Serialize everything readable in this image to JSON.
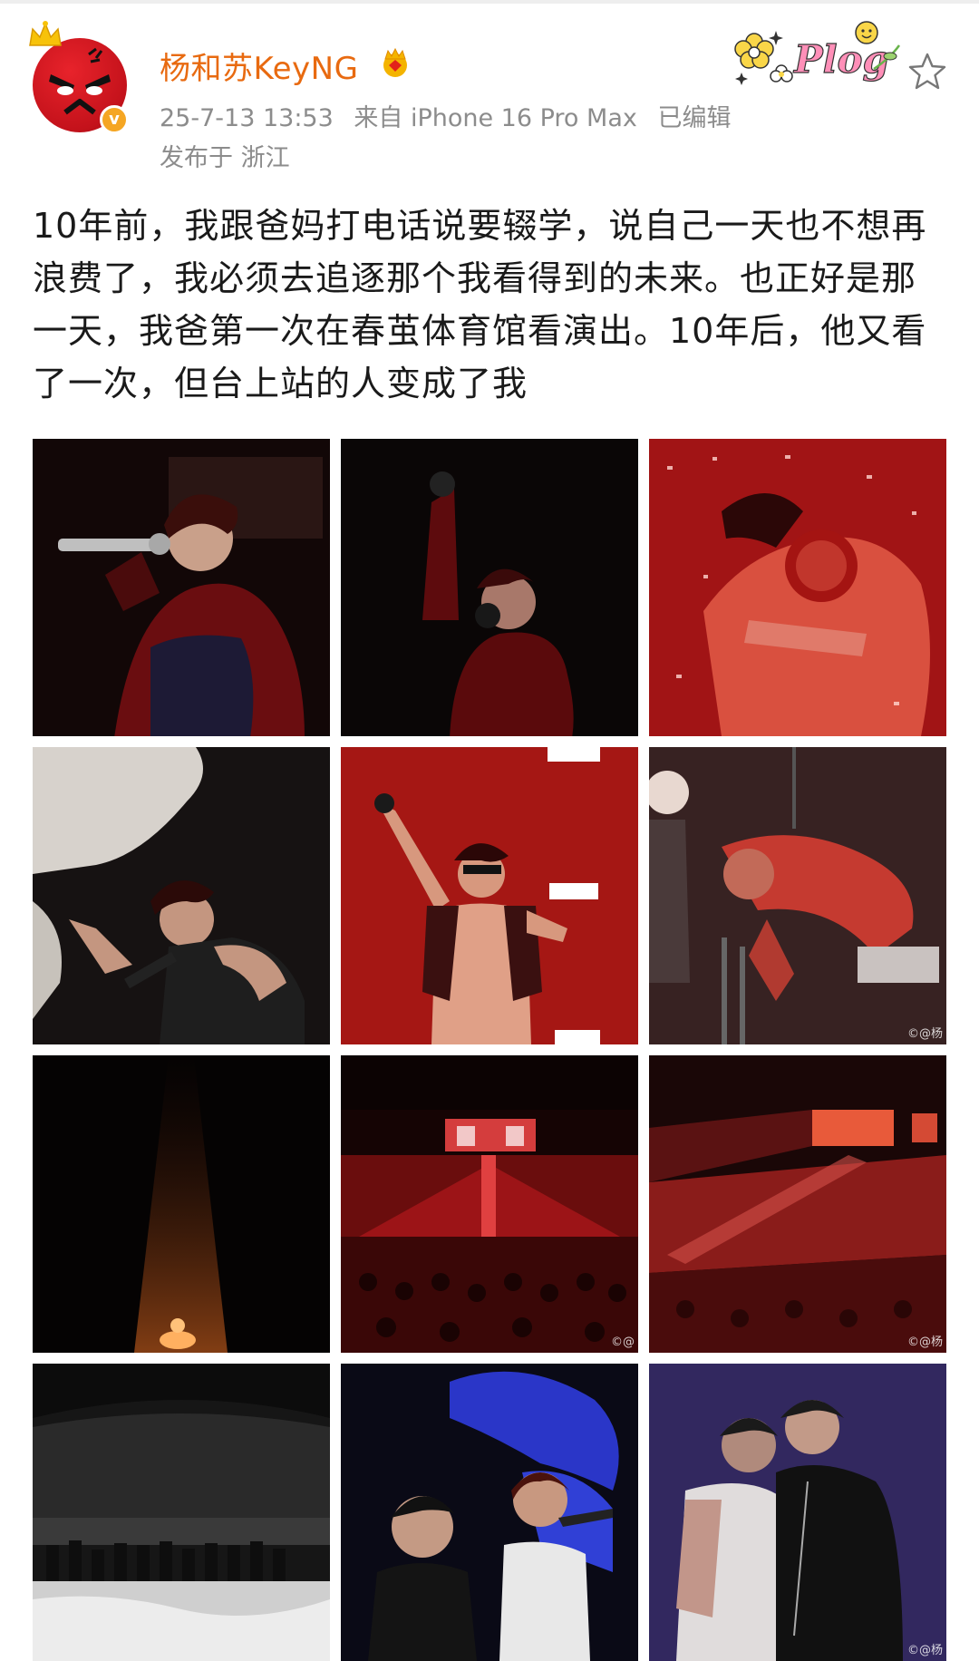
{
  "post": {
    "username": "杨和苏KeyNG",
    "timestamp": "25-7-13 13:53",
    "source": "来自 iPhone 16 Pro Max",
    "edited": "已编辑",
    "location": "发布于 浙江",
    "text": "10年前，我跟爸妈打电话说要辍学，说自己一天也不想再浪费了，我必须去追逐那个我看得到的未来。也正好是那一天，我爸第一次在春茧体育馆看演出。10年后，他又看了一次，但台上站的人变成了我",
    "sticker_text": "Plog"
  },
  "photos": [
    {
      "wm": ""
    },
    {
      "wm": ""
    },
    {
      "wm": ""
    },
    {
      "wm": ""
    },
    {
      "wm": ""
    },
    {
      "wm": "©@杨"
    },
    {
      "wm": ""
    },
    {
      "wm": "©@"
    },
    {
      "wm": "©@杨"
    },
    {
      "wm": ""
    },
    {
      "wm": ""
    },
    {
      "wm": "©@杨"
    }
  ],
  "colors": {
    "username": "#e86a10",
    "meta": "#8c8c8c",
    "text": "#1a1a1a",
    "verified_badge": "#f5a623",
    "avatar": "#c4121b"
  },
  "icons": [
    "crown-icon",
    "verified-icon",
    "vip-crown-icon",
    "star-icon"
  ]
}
